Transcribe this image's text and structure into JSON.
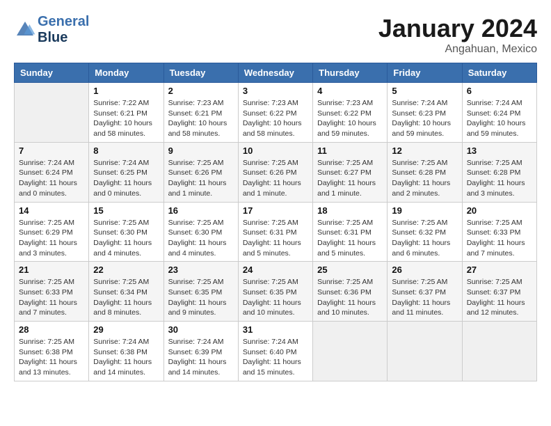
{
  "header": {
    "logo_line1": "General",
    "logo_line2": "Blue",
    "month": "January 2024",
    "location": "Angahuan, Mexico"
  },
  "weekdays": [
    "Sunday",
    "Monday",
    "Tuesday",
    "Wednesday",
    "Thursday",
    "Friday",
    "Saturday"
  ],
  "weeks": [
    [
      {
        "day": "",
        "empty": true
      },
      {
        "day": "1",
        "sunrise": "Sunrise: 7:22 AM",
        "sunset": "Sunset: 6:21 PM",
        "daylight": "Daylight: 10 hours and 58 minutes."
      },
      {
        "day": "2",
        "sunrise": "Sunrise: 7:23 AM",
        "sunset": "Sunset: 6:21 PM",
        "daylight": "Daylight: 10 hours and 58 minutes."
      },
      {
        "day": "3",
        "sunrise": "Sunrise: 7:23 AM",
        "sunset": "Sunset: 6:22 PM",
        "daylight": "Daylight: 10 hours and 58 minutes."
      },
      {
        "day": "4",
        "sunrise": "Sunrise: 7:23 AM",
        "sunset": "Sunset: 6:22 PM",
        "daylight": "Daylight: 10 hours and 59 minutes."
      },
      {
        "day": "5",
        "sunrise": "Sunrise: 7:24 AM",
        "sunset": "Sunset: 6:23 PM",
        "daylight": "Daylight: 10 hours and 59 minutes."
      },
      {
        "day": "6",
        "sunrise": "Sunrise: 7:24 AM",
        "sunset": "Sunset: 6:24 PM",
        "daylight": "Daylight: 10 hours and 59 minutes."
      }
    ],
    [
      {
        "day": "7",
        "sunrise": "Sunrise: 7:24 AM",
        "sunset": "Sunset: 6:24 PM",
        "daylight": "Daylight: 11 hours and 0 minutes."
      },
      {
        "day": "8",
        "sunrise": "Sunrise: 7:24 AM",
        "sunset": "Sunset: 6:25 PM",
        "daylight": "Daylight: 11 hours and 0 minutes."
      },
      {
        "day": "9",
        "sunrise": "Sunrise: 7:25 AM",
        "sunset": "Sunset: 6:26 PM",
        "daylight": "Daylight: 11 hours and 1 minute."
      },
      {
        "day": "10",
        "sunrise": "Sunrise: 7:25 AM",
        "sunset": "Sunset: 6:26 PM",
        "daylight": "Daylight: 11 hours and 1 minute."
      },
      {
        "day": "11",
        "sunrise": "Sunrise: 7:25 AM",
        "sunset": "Sunset: 6:27 PM",
        "daylight": "Daylight: 11 hours and 1 minute."
      },
      {
        "day": "12",
        "sunrise": "Sunrise: 7:25 AM",
        "sunset": "Sunset: 6:28 PM",
        "daylight": "Daylight: 11 hours and 2 minutes."
      },
      {
        "day": "13",
        "sunrise": "Sunrise: 7:25 AM",
        "sunset": "Sunset: 6:28 PM",
        "daylight": "Daylight: 11 hours and 3 minutes."
      }
    ],
    [
      {
        "day": "14",
        "sunrise": "Sunrise: 7:25 AM",
        "sunset": "Sunset: 6:29 PM",
        "daylight": "Daylight: 11 hours and 3 minutes."
      },
      {
        "day": "15",
        "sunrise": "Sunrise: 7:25 AM",
        "sunset": "Sunset: 6:30 PM",
        "daylight": "Daylight: 11 hours and 4 minutes."
      },
      {
        "day": "16",
        "sunrise": "Sunrise: 7:25 AM",
        "sunset": "Sunset: 6:30 PM",
        "daylight": "Daylight: 11 hours and 4 minutes."
      },
      {
        "day": "17",
        "sunrise": "Sunrise: 7:25 AM",
        "sunset": "Sunset: 6:31 PM",
        "daylight": "Daylight: 11 hours and 5 minutes."
      },
      {
        "day": "18",
        "sunrise": "Sunrise: 7:25 AM",
        "sunset": "Sunset: 6:31 PM",
        "daylight": "Daylight: 11 hours and 5 minutes."
      },
      {
        "day": "19",
        "sunrise": "Sunrise: 7:25 AM",
        "sunset": "Sunset: 6:32 PM",
        "daylight": "Daylight: 11 hours and 6 minutes."
      },
      {
        "day": "20",
        "sunrise": "Sunrise: 7:25 AM",
        "sunset": "Sunset: 6:33 PM",
        "daylight": "Daylight: 11 hours and 7 minutes."
      }
    ],
    [
      {
        "day": "21",
        "sunrise": "Sunrise: 7:25 AM",
        "sunset": "Sunset: 6:33 PM",
        "daylight": "Daylight: 11 hours and 7 minutes."
      },
      {
        "day": "22",
        "sunrise": "Sunrise: 7:25 AM",
        "sunset": "Sunset: 6:34 PM",
        "daylight": "Daylight: 11 hours and 8 minutes."
      },
      {
        "day": "23",
        "sunrise": "Sunrise: 7:25 AM",
        "sunset": "Sunset: 6:35 PM",
        "daylight": "Daylight: 11 hours and 9 minutes."
      },
      {
        "day": "24",
        "sunrise": "Sunrise: 7:25 AM",
        "sunset": "Sunset: 6:35 PM",
        "daylight": "Daylight: 11 hours and 10 minutes."
      },
      {
        "day": "25",
        "sunrise": "Sunrise: 7:25 AM",
        "sunset": "Sunset: 6:36 PM",
        "daylight": "Daylight: 11 hours and 10 minutes."
      },
      {
        "day": "26",
        "sunrise": "Sunrise: 7:25 AM",
        "sunset": "Sunset: 6:37 PM",
        "daylight": "Daylight: 11 hours and 11 minutes."
      },
      {
        "day": "27",
        "sunrise": "Sunrise: 7:25 AM",
        "sunset": "Sunset: 6:37 PM",
        "daylight": "Daylight: 11 hours and 12 minutes."
      }
    ],
    [
      {
        "day": "28",
        "sunrise": "Sunrise: 7:25 AM",
        "sunset": "Sunset: 6:38 PM",
        "daylight": "Daylight: 11 hours and 13 minutes."
      },
      {
        "day": "29",
        "sunrise": "Sunrise: 7:24 AM",
        "sunset": "Sunset: 6:38 PM",
        "daylight": "Daylight: 11 hours and 14 minutes."
      },
      {
        "day": "30",
        "sunrise": "Sunrise: 7:24 AM",
        "sunset": "Sunset: 6:39 PM",
        "daylight": "Daylight: 11 hours and 14 minutes."
      },
      {
        "day": "31",
        "sunrise": "Sunrise: 7:24 AM",
        "sunset": "Sunset: 6:40 PM",
        "daylight": "Daylight: 11 hours and 15 minutes."
      },
      {
        "day": "",
        "empty": true
      },
      {
        "day": "",
        "empty": true
      },
      {
        "day": "",
        "empty": true
      }
    ]
  ]
}
